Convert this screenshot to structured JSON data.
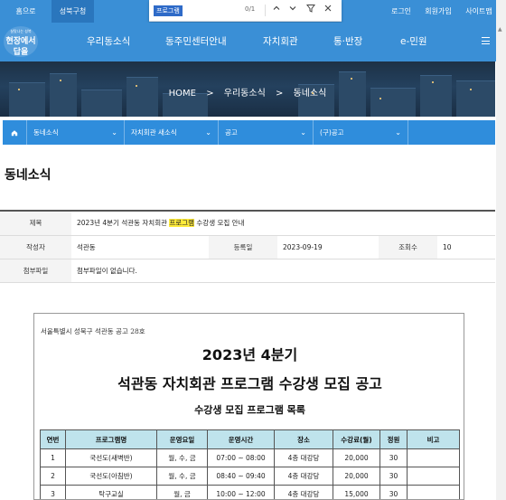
{
  "topbar": {
    "home": "홈으로",
    "office": "성북구청",
    "login": "로그인",
    "join": "회원가입",
    "sitemap": "사이트맵"
  },
  "findbar": {
    "query": "프로그램",
    "count": "0/1"
  },
  "logo": {
    "text": "현장에서 답을"
  },
  "nav": {
    "items": [
      "우리동소식",
      "동주민센터안내",
      "자치회관",
      "통·반장",
      "e-민원"
    ]
  },
  "breadcrumb": {
    "home": "HOME",
    "sep": ">",
    "level1": "우리동소식",
    "level2": "동네소식"
  },
  "subnav": {
    "home_icon": "home-icon",
    "items": [
      "동네소식",
      "자치회관 새소식",
      "공고",
      "(구)공고"
    ]
  },
  "page": {
    "title": "동네소식"
  },
  "info": {
    "title_label": "제목",
    "title_pre": "2023년 4분기 석관동 자치회관 ",
    "title_hl": "프로그램",
    "title_post": " 수강생 모집 안내",
    "author_label": "작성자",
    "author": "석관동",
    "date_label": "등록일",
    "date": "2023-09-19",
    "views_label": "조회수",
    "views": "10",
    "attach_label": "첨부파일",
    "attach": "첨부파일이 없습니다."
  },
  "doc": {
    "org": "서울특별시 성북구 석관동 공고 28호",
    "heading1": "2023년 4분기",
    "heading2": "석관동 자치회관 프로그램 수강생 모집 공고",
    "heading3": "수강생 모집 프로그램 목록",
    "columns": [
      "연번",
      "프로그램명",
      "운영요일",
      "운영시간",
      "장소",
      "수강료(월)",
      "정원",
      "비고"
    ],
    "rows": [
      [
        "1",
        "국선도(새벽반)",
        "월, 수, 금",
        "07:00 ~ 08:00",
        "4층 대강당",
        "20,000",
        "30",
        ""
      ],
      [
        "2",
        "국선도(아침반)",
        "월, 수, 금",
        "08:40 ~ 09:40",
        "4층 대강당",
        "20,000",
        "30",
        ""
      ],
      [
        "3",
        "탁구교실",
        "월, 금",
        "10:00 ~ 12:00",
        "4층 대강당",
        "15,000",
        "30",
        ""
      ]
    ]
  },
  "colors": {
    "brand_blue": "#3a8fd6",
    "subnav_blue": "#2f8ddc",
    "table_header": "#bfe3ec",
    "highlight": "#ffeb3b"
  }
}
